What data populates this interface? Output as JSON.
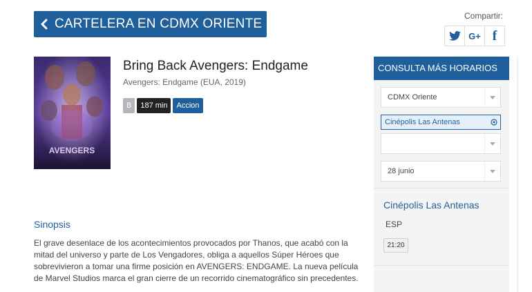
{
  "header": {
    "back_title": "CARTELERA EN CDMX ORIENTE",
    "back_icon": "chevron-left-icon"
  },
  "share": {
    "label": "Compartir:",
    "twitter_icon": "twitter-icon",
    "gplus_label": "G+",
    "facebook_label": "f"
  },
  "movie": {
    "title": "Bring Back Avengers: Endgame",
    "subtitle": "Avengers: Endgame (EUA, 2019)",
    "rating": "B",
    "duration": "187 min",
    "genre": "Accion",
    "poster_text": "AVENGERS"
  },
  "synopsis": {
    "title": "Sinopsis",
    "text": "El grave desenlace de los acontecimientos provocados por Thanos, que acabó con la mitad del universo y parte de Los Vengadores, obliga a aquellos Súper Héroes que sobrevivieron a tomar una firme posición en AVENGERS: ENDGAME. La nueva película de Marvel Studios marca el gran cierre de un recorrido cinematográfico sin precedentes."
  },
  "sidebar": {
    "heading": "CONSULTA MÁS HORARIOS",
    "city_select": "CDMX Oriente",
    "cinema_chip": "Cinépolis Las Antenas",
    "third_select": "",
    "date_select": "28 junio",
    "result": {
      "cinema": "Cinépolis Las Antenas",
      "language": "ESP",
      "times": [
        "21:20"
      ]
    }
  },
  "colors": {
    "brand_blue": "#1f5f9b",
    "duration_tag": "#222222",
    "rating_tag": "#b5b5bd"
  }
}
